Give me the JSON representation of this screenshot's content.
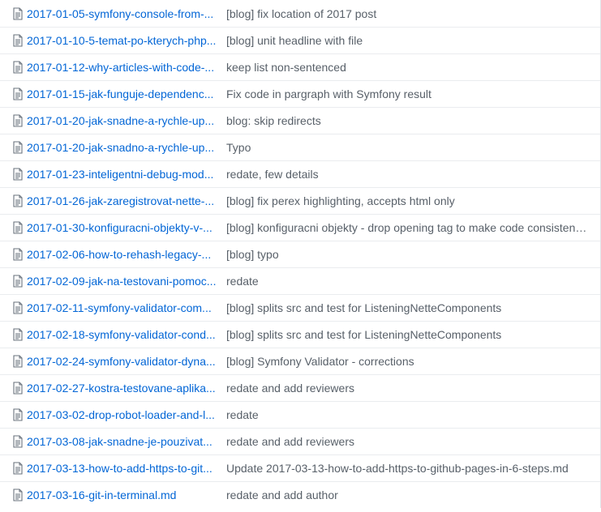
{
  "files": [
    {
      "name": "2017-01-05-symfony-console-from-...",
      "message": "[blog] fix location of 2017 post"
    },
    {
      "name": "2017-01-10-5-temat-po-kterych-php...",
      "message": "[blog] unit headline with file"
    },
    {
      "name": "2017-01-12-why-articles-with-code-...",
      "message": "keep list non-sentenced"
    },
    {
      "name": "2017-01-15-jak-funguje-dependenc...",
      "message": "Fix code in pargraph with Symfony result"
    },
    {
      "name": "2017-01-20-jak-snadne-a-rychle-up...",
      "message": "blog: skip redirects"
    },
    {
      "name": "2017-01-20-jak-snadno-a-rychle-up...",
      "message": "Typo"
    },
    {
      "name": "2017-01-23-inteligentni-debug-mod...",
      "message": "redate, few details"
    },
    {
      "name": "2017-01-26-jak-zaregistrovat-nette-...",
      "message": "[blog] fix perex highlighting, accepts html only"
    },
    {
      "name": "2017-01-30-konfiguracni-objekty-v-...",
      "message": "[blog] konfiguracni objekty - drop opening tag to make code consisten…"
    },
    {
      "name": "2017-02-06-how-to-rehash-legacy-...",
      "message": "[blog] typo"
    },
    {
      "name": "2017-02-09-jak-na-testovani-pomoc...",
      "message": "redate"
    },
    {
      "name": "2017-02-11-symfony-validator-com...",
      "message": "[blog] splits src and test for ListeningNetteComponents"
    },
    {
      "name": "2017-02-18-symfony-validator-cond...",
      "message": "[blog] splits src and test for ListeningNetteComponents"
    },
    {
      "name": "2017-02-24-symfony-validator-dyna...",
      "message": "[blog] Symfony Validator - corrections"
    },
    {
      "name": "2017-02-27-kostra-testovane-aplika...",
      "message": "redate and add reviewers"
    },
    {
      "name": "2017-03-02-drop-robot-loader-and-l...",
      "message": "redate"
    },
    {
      "name": "2017-03-08-jak-snadne-je-pouzivat...",
      "message": "redate and add reviewers"
    },
    {
      "name": "2017-03-13-how-to-add-https-to-git...",
      "message": "Update 2017-03-13-how-to-add-https-to-github-pages-in-6-steps.md"
    },
    {
      "name": "2017-03-16-git-in-terminal.md",
      "message": "redate and add author"
    }
  ],
  "icon": "file-text-icon",
  "colors": {
    "link": "#0366d6",
    "message": "#586069",
    "icon": "#6a737d",
    "border": "#eaecef"
  }
}
